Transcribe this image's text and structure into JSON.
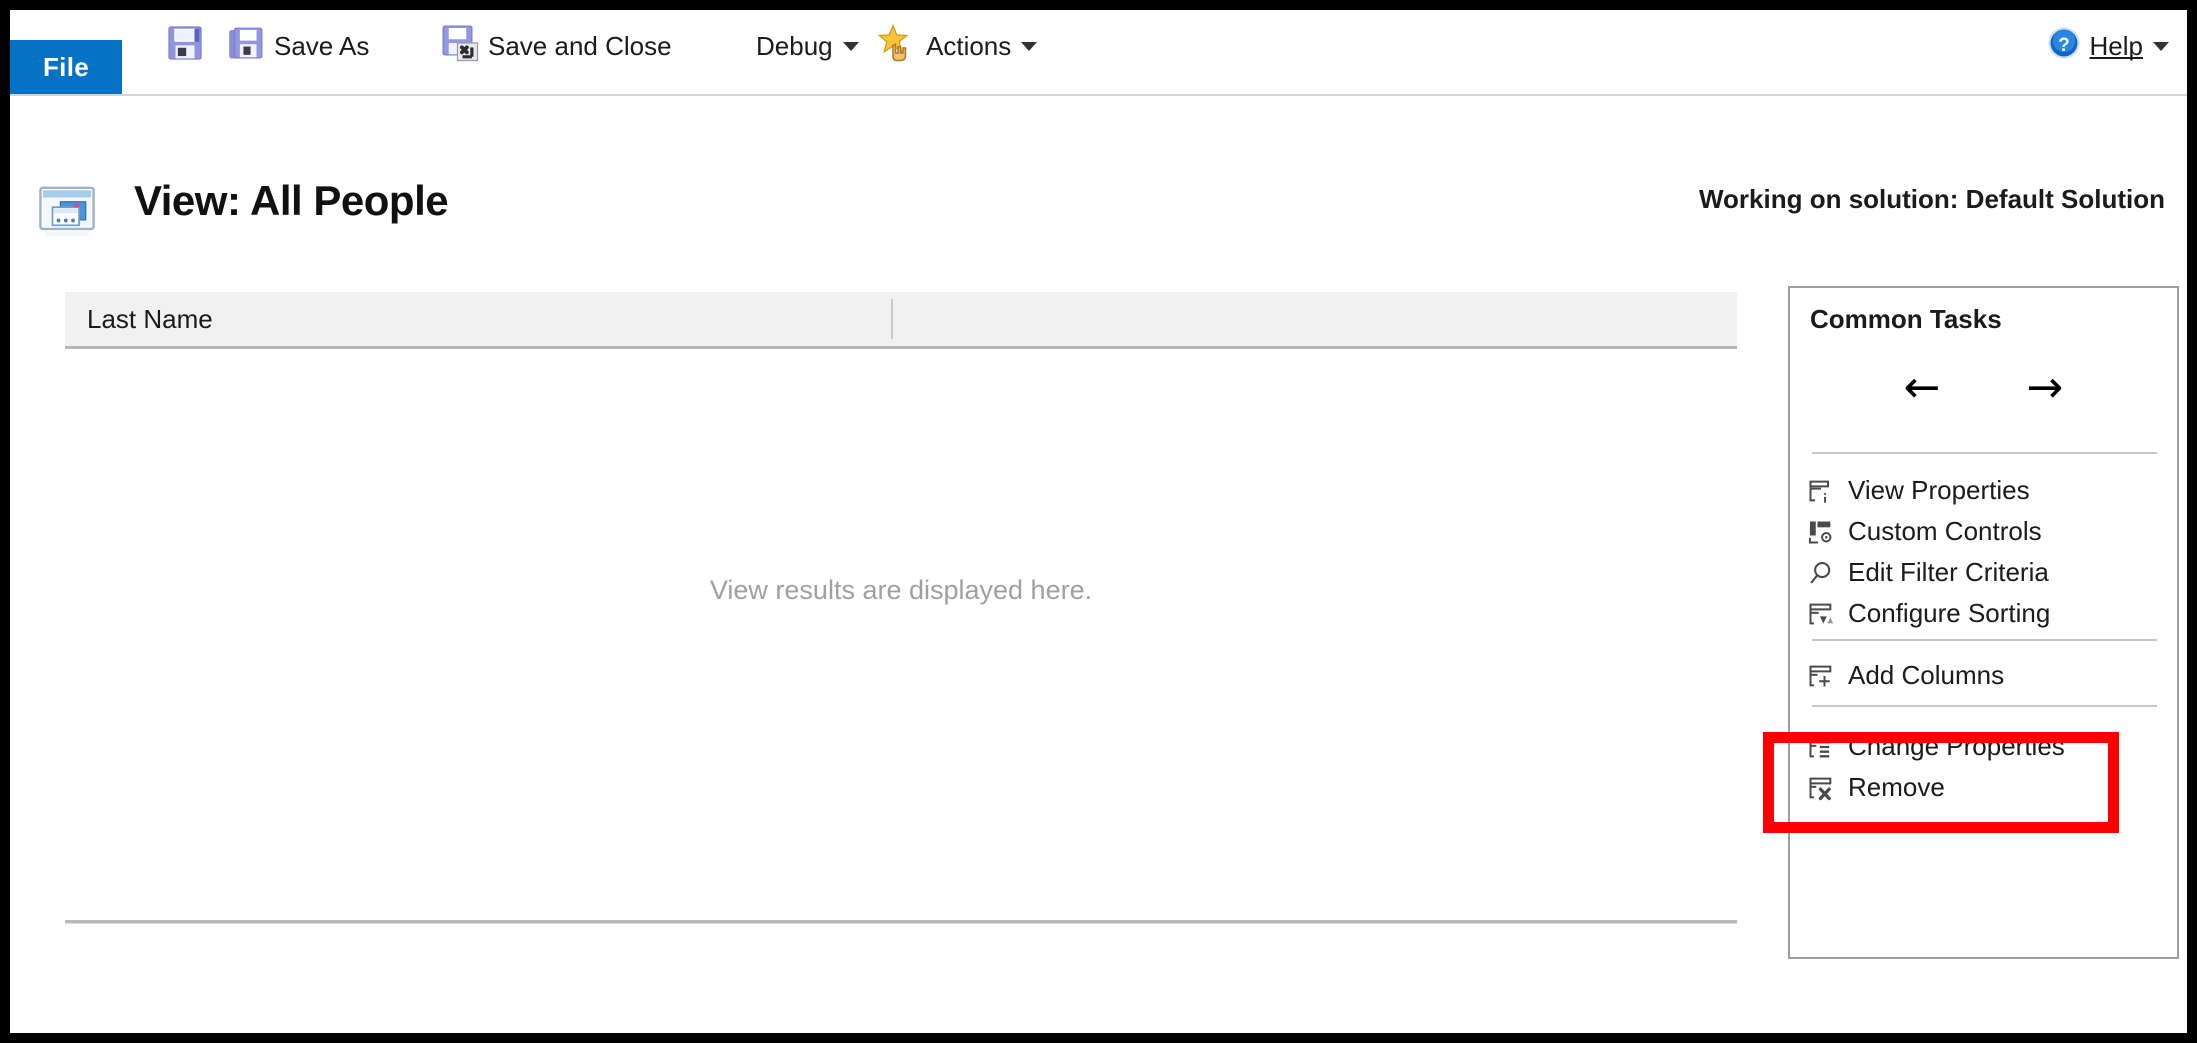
{
  "window": {
    "border_color": "#000000",
    "accent_color": "#0672c4",
    "highlight_color": "#fe0000"
  },
  "ribbon": {
    "file_tab": "File",
    "items": [
      {
        "label": "",
        "icon": "save-icon",
        "has_caret": false
      },
      {
        "label": "Save As",
        "icon": "save-as-icon",
        "has_caret": false
      },
      {
        "label": "Save and Close",
        "icon": "save-and-close-icon",
        "has_caret": false
      },
      {
        "label": "Debug",
        "icon": "",
        "has_caret": true
      },
      {
        "label": "Actions",
        "icon": "actions-star-icon",
        "has_caret": true
      }
    ],
    "help": {
      "label": "Help",
      "icon": "help-icon",
      "has_caret": true
    }
  },
  "header": {
    "icon": "view-window-icon",
    "title": "View: All People",
    "solution": "Working on solution: Default Solution"
  },
  "grid": {
    "columns": [
      "Last Name"
    ],
    "empty_message": "View results are displayed here.",
    "rows": []
  },
  "common_tasks": {
    "title": "Common Tasks",
    "nav": {
      "back": "←",
      "forward": "→"
    },
    "groups": [
      {
        "items": [
          {
            "label": "View Properties",
            "icon": "view-properties-icon"
          },
          {
            "label": "Custom Controls",
            "icon": "custom-controls-icon"
          },
          {
            "label": "Edit Filter Criteria",
            "icon": "magnifier-icon"
          },
          {
            "label": "Configure Sorting",
            "icon": "sort-icon"
          }
        ]
      },
      {
        "items": [
          {
            "label": "Add Columns",
            "icon": "add-column-icon",
            "highlighted": true
          }
        ]
      },
      {
        "items": [
          {
            "label": "Change Properties",
            "icon": "change-properties-icon"
          },
          {
            "label": "Remove",
            "icon": "remove-column-icon"
          }
        ]
      }
    ]
  }
}
